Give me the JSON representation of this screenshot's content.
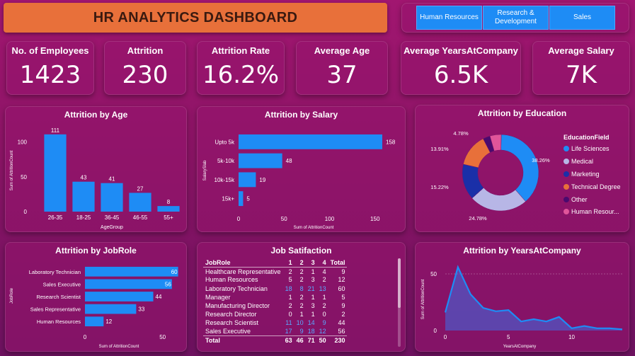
{
  "header": {
    "title": "HR ANALYTICS DASHBOARD"
  },
  "departments": [
    {
      "label": "Human Resources"
    },
    {
      "label": "Research & Development"
    },
    {
      "label": "Sales"
    }
  ],
  "kpis": [
    {
      "label": "No. of Employees",
      "value": "1423"
    },
    {
      "label": "Attrition",
      "value": "230"
    },
    {
      "label": "Attrition Rate",
      "value": "16.2%"
    },
    {
      "label": "Average Age",
      "value": "37"
    },
    {
      "label": "Average YearsAtCompany",
      "value": "6.5K"
    },
    {
      "label": "Average Salary",
      "value": "7K"
    }
  ],
  "colors": {
    "bar": "#1e8cf5",
    "title_bar": "#e8703a",
    "edu_life_sciences": "#1e8cf5",
    "edu_medical": "#b7b6e6",
    "edu_marketing": "#1a2fa8",
    "edu_technical": "#e8703a",
    "edu_other": "#4a0a6e",
    "edu_hr": "#e0559a"
  },
  "chart_data": [
    {
      "id": "age",
      "type": "bar",
      "title": "Attrition by Age",
      "xlabel": "AgeGroup",
      "ylabel": "Sum of AttritionCount",
      "categories": [
        "26-35",
        "18-25",
        "36-45",
        "46-55",
        "55+"
      ],
      "values": [
        111,
        43,
        41,
        27,
        8
      ],
      "yticks": [
        0,
        50,
        100
      ],
      "ylim": [
        0,
        120
      ]
    },
    {
      "id": "salary",
      "type": "bar",
      "orientation": "horizontal",
      "title": "Attrition by Salary",
      "xlabel": "Sum of AttritionCount",
      "ylabel": "SalarySlab",
      "categories": [
        "Upto 5k",
        "5k-10k",
        "10k-15k",
        "15k+"
      ],
      "values": [
        158,
        48,
        19,
        5
      ],
      "xticks": [
        0,
        50,
        100,
        150
      ],
      "xlim": [
        0,
        165
      ]
    },
    {
      "id": "education",
      "type": "pie",
      "title": "Attrition by Education",
      "legend_title": "EducationField",
      "categories": [
        "Life Sciences",
        "Medical",
        "Marketing",
        "Technical Degree",
        "Other",
        "Human Resour..."
      ],
      "values": [
        38.26,
        24.78,
        15.22,
        13.91,
        3.05,
        4.78
      ],
      "value_labels": [
        "38.26%",
        "24.78%",
        "15.22%",
        "13.91%",
        "",
        "4.78%"
      ]
    },
    {
      "id": "jobrole",
      "type": "bar",
      "orientation": "horizontal",
      "title": "Attrition by JobRole",
      "xlabel": "Sum of AttritionCount",
      "ylabel": "JobRole",
      "categories": [
        "Laboratory Technician",
        "Sales Executive",
        "Research Scientist",
        "Sales Representative",
        "Human Resources"
      ],
      "values": [
        60,
        56,
        44,
        33,
        12
      ],
      "xticks": [
        0,
        50
      ],
      "xlim": [
        0,
        62
      ]
    },
    {
      "id": "years",
      "type": "area",
      "title": "Attrition by YearsAtCompany",
      "xlabel": "YearsAtCompany",
      "ylabel": "Sum of AttritionCount",
      "x": [
        0,
        1,
        2,
        3,
        4,
        5,
        6,
        7,
        8,
        9,
        10,
        11,
        12,
        13,
        14
      ],
      "values": [
        16,
        56,
        32,
        20,
        17,
        18,
        8,
        10,
        8,
        12,
        2,
        4,
        2,
        2,
        1
      ],
      "xticks": [
        0,
        5,
        10
      ],
      "yticks": [
        0,
        50
      ],
      "xlim": [
        0,
        14
      ],
      "ylim": [
        0,
        60
      ]
    }
  ],
  "job_satisfaction": {
    "title": "Job Satifaction",
    "headers": [
      "JobRole",
      "1",
      "2",
      "3",
      "4",
      "Total"
    ],
    "rows": [
      [
        "Healthcare Representative",
        "2",
        "2",
        "1",
        "4",
        "9"
      ],
      [
        "Human Resources",
        "5",
        "2",
        "3",
        "2",
        "12"
      ],
      [
        "Laboratory Technician",
        "18",
        "8",
        "21",
        "13",
        "60"
      ],
      [
        "Manager",
        "1",
        "2",
        "1",
        "1",
        "5"
      ],
      [
        "Manufacturing Director",
        "2",
        "2",
        "3",
        "2",
        "9"
      ],
      [
        "Research Director",
        "0",
        "1",
        "1",
        "0",
        "2"
      ],
      [
        "Research Scientist",
        "11",
        "10",
        "14",
        "9",
        "44"
      ],
      [
        "Sales Executive",
        "17",
        "9",
        "18",
        "12",
        "56"
      ]
    ],
    "total": [
      "Total",
      "63",
      "46",
      "71",
      "50",
      "230"
    ],
    "highlight_rows": [
      2,
      6,
      7
    ]
  }
}
